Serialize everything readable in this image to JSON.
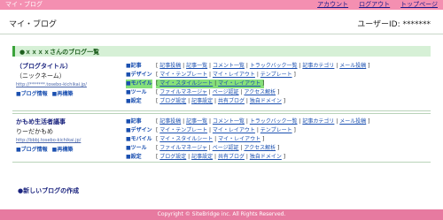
{
  "topbar": {
    "app_title": "マイ・ブログ",
    "links": [
      "アカウント",
      "ログアウト",
      "トップページ"
    ]
  },
  "header": {
    "title": "マイ・ブログ",
    "userid": "ユーザーID: *******"
  },
  "list_heading": "●ｘｘｘｘさんのブログ一覧",
  "blogs": [
    {
      "name": "（ブログタイトル）",
      "nick": "（ニックネーム）",
      "url": "http://*******.tosebo-kichikai.jp/",
      "actions": [
        "■ブログ情報",
        "■再構築"
      ],
      "menu": [
        {
          "cat": "■記事",
          "links": [
            "記事投稿",
            "記事一覧",
            "コメント一覧",
            "トラックバック一覧",
            "記事カテゴリ",
            "メール投稿"
          ]
        },
        {
          "cat": "■デザイン",
          "links": [
            "マイ・テンプレート",
            "マイ・レイアウト",
            "テンプレート"
          ]
        },
        {
          "cat": "■モバイル",
          "links": [
            "マイ・スタイルシート",
            "マイ・レイアウト"
          ]
        },
        {
          "cat": "■ツール",
          "links": [
            "ファイルマネージャ",
            "ページ認証",
            "アクセス解析"
          ]
        },
        {
          "cat": "■設定",
          "links": [
            "ブログ設定",
            "記事設定",
            "共有ブログ",
            "独自ドメイン"
          ]
        }
      ]
    },
    {
      "name": "かもめ生活者議事",
      "nick": "りーだかもめ",
      "url": "http://bbbj.tosebo-kichikai.jp/",
      "actions": [
        "■ブログ情報",
        "■再構築"
      ],
      "menu": [
        {
          "cat": "■記事",
          "links": [
            "記事投稿",
            "記事一覧",
            "コメント一覧",
            "トラックバック一覧",
            "記事カテゴリ",
            "メール投稿"
          ]
        },
        {
          "cat": "■デザイン",
          "links": [
            "マイ・テンプレート",
            "マイ・レイアウト",
            "テンプレート"
          ]
        },
        {
          "cat": "■モバイル",
          "links": [
            "マイ・スタイルシート",
            "マイ・レイアウト"
          ]
        },
        {
          "cat": "■ツール",
          "links": [
            "ファイルマネージャ",
            "ページ認証",
            "アクセス解析"
          ]
        },
        {
          "cat": "■設定",
          "links": [
            "ブログ設定",
            "記事設定",
            "共有ブログ",
            "独自ドメイン"
          ]
        }
      ]
    }
  ],
  "new_blog": "●新しいブログの作成",
  "footer": "Copyright © SiteBridge inc. All Rights Reserved.",
  "colors": {
    "topbar": "#f48fb1",
    "footer": "#e77aa0",
    "highlight": "#86e07a",
    "heading_bg": "#d6f0d6"
  }
}
